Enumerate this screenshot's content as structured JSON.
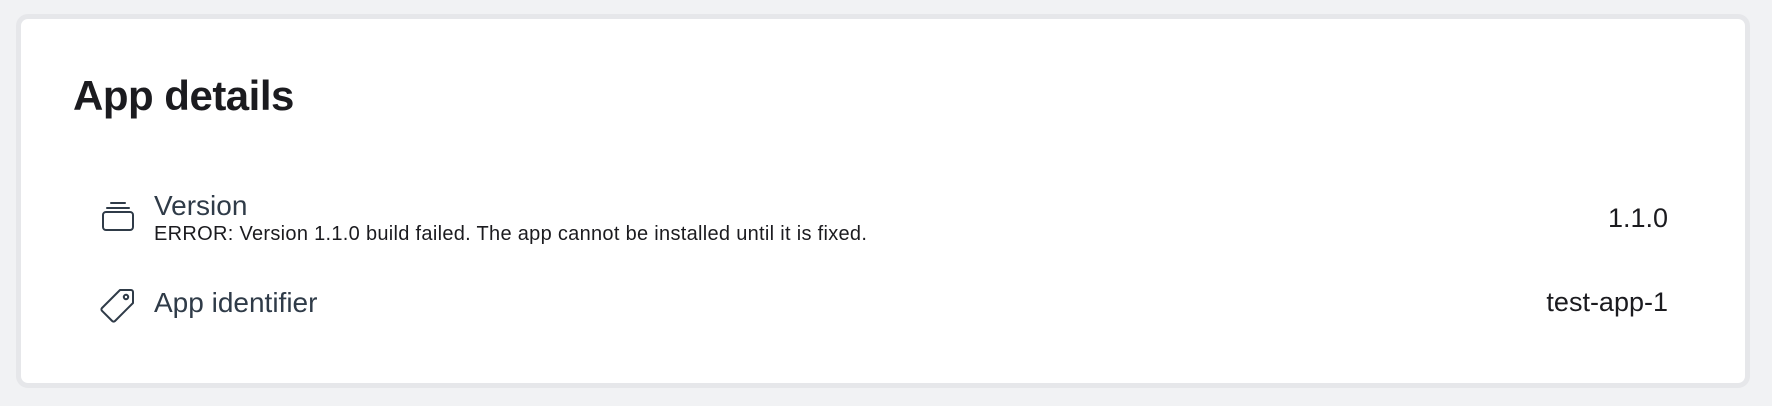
{
  "app_details": {
    "title": "App details",
    "rows": [
      {
        "icon": "stack-icon",
        "label": "Version",
        "message": "ERROR: Version 1.1.0 build failed. The app cannot be installed until it is fixed.",
        "value": "1.1.0"
      },
      {
        "icon": "tag-icon",
        "label": "App identifier",
        "value": "test-app-1"
      }
    ]
  },
  "colors": {
    "page_background": "#f1f2f4",
    "card_background": "#ffffff",
    "card_border": "#e6e7ea",
    "label_text": "#2f3b48",
    "body_text": "#1b1b1f"
  }
}
